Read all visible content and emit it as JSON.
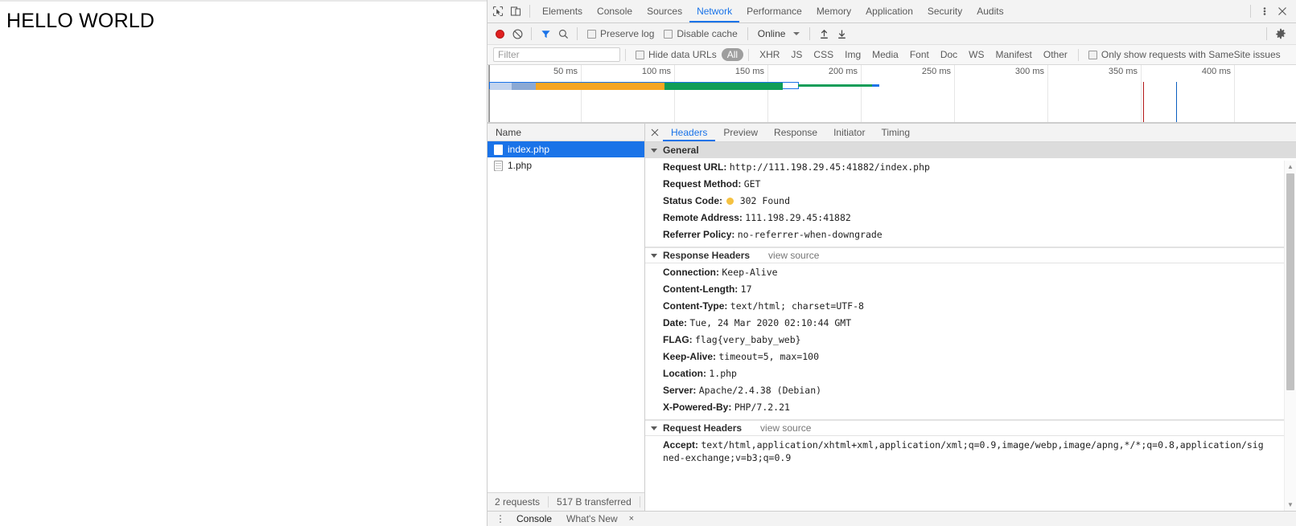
{
  "page": {
    "heading": "HELLO WORLD"
  },
  "devtools": {
    "main_tabs": [
      {
        "label": "Elements",
        "active": false
      },
      {
        "label": "Console",
        "active": false
      },
      {
        "label": "Sources",
        "active": false
      },
      {
        "label": "Network",
        "active": true
      },
      {
        "label": "Performance",
        "active": false
      },
      {
        "label": "Memory",
        "active": false
      },
      {
        "label": "Application",
        "active": false
      },
      {
        "label": "Security",
        "active": false
      },
      {
        "label": "Audits",
        "active": false
      }
    ],
    "inspect_icon": "inspect-element-icon",
    "device_icon": "device-toolbar-icon",
    "more_icon": "kebab-menu-icon",
    "close_icon": "close-icon",
    "network_toolbar": {
      "record_icon": "record-button-icon",
      "clear_icon": "clear-icon",
      "filter_icon": "filter-funnel-icon",
      "search_icon": "search-icon",
      "preserve_log_label": "Preserve log",
      "preserve_log_checked": false,
      "disable_cache_label": "Disable cache",
      "disable_cache_checked": false,
      "throttle_value": "Online",
      "import_icon": "import-har-icon",
      "export_icon": "export-har-icon",
      "settings_icon": "gear-icon"
    },
    "filter_bar": {
      "filter_placeholder": "Filter",
      "filter_value": "",
      "hide_data_urls_label": "Hide data URLs",
      "hide_data_urls_checked": false,
      "types": [
        {
          "label": "All",
          "active": true
        },
        {
          "label": "XHR",
          "active": false
        },
        {
          "label": "JS",
          "active": false
        },
        {
          "label": "CSS",
          "active": false
        },
        {
          "label": "Img",
          "active": false
        },
        {
          "label": "Media",
          "active": false
        },
        {
          "label": "Font",
          "active": false
        },
        {
          "label": "Doc",
          "active": false
        },
        {
          "label": "WS",
          "active": false
        },
        {
          "label": "Manifest",
          "active": false
        },
        {
          "label": "Other",
          "active": false
        }
      ],
      "samesite_label": "Only show requests with SameSite issues",
      "samesite_checked": false
    },
    "overview": {
      "ticks": [
        "50 ms",
        "100 ms",
        "150 ms",
        "200 ms",
        "250 ms",
        "300 ms",
        "350 ms",
        "400 ms"
      ],
      "colors": {
        "queueing": "#b3c9e8",
        "stalled": "#8ba9d4",
        "waiting": "#f5a623",
        "download": "#0f9d58",
        "border": "#1a73e8",
        "dom_content_loaded": "#0b5fbf",
        "load": "#b31919"
      }
    },
    "request_list": {
      "column_header": "Name",
      "rows": [
        {
          "name": "index.php",
          "selected": true
        },
        {
          "name": "1.php",
          "selected": false
        }
      ],
      "footer": {
        "requests": "2 requests",
        "transferred": "517 B transferred"
      }
    },
    "detail": {
      "tabs": [
        {
          "label": "Headers",
          "active": true
        },
        {
          "label": "Preview",
          "active": false
        },
        {
          "label": "Response",
          "active": false
        },
        {
          "label": "Initiator",
          "active": false
        },
        {
          "label": "Timing",
          "active": false
        }
      ],
      "sections": [
        {
          "title": "General",
          "style": "filled",
          "view_source": "",
          "rows": [
            {
              "key": "Request URL:",
              "value": "http://111.198.29.45:41882/index.php"
            },
            {
              "key": "Request Method:",
              "value": "GET"
            },
            {
              "key": "Status Code:",
              "value": "302 Found",
              "status_dot": true
            },
            {
              "key": "Remote Address:",
              "value": "111.198.29.45:41882"
            },
            {
              "key": "Referrer Policy:",
              "value": "no-referrer-when-downgrade"
            }
          ]
        },
        {
          "title": "Response Headers",
          "style": "plain",
          "view_source": "view source",
          "rows": [
            {
              "key": "Connection:",
              "value": "Keep-Alive"
            },
            {
              "key": "Content-Length:",
              "value": "17"
            },
            {
              "key": "Content-Type:",
              "value": "text/html; charset=UTF-8"
            },
            {
              "key": "Date:",
              "value": "Tue, 24 Mar 2020 02:10:44 GMT"
            },
            {
              "key": "FLAG:",
              "value": "flag{very_baby_web}"
            },
            {
              "key": "Keep-Alive:",
              "value": "timeout=5, max=100"
            },
            {
              "key": "Location:",
              "value": "1.php"
            },
            {
              "key": "Server:",
              "value": "Apache/2.4.38 (Debian)"
            },
            {
              "key": "X-Powered-By:",
              "value": "PHP/7.2.21"
            }
          ]
        },
        {
          "title": "Request Headers",
          "style": "plain",
          "view_source": "view source",
          "rows": [
            {
              "key": "Accept:",
              "value": "text/html,application/xhtml+xml,application/xml;q=0.9,image/webp,image/apng,*/*;q=0.8,application/signed-exchange;v=b3;q=0.9"
            }
          ]
        }
      ]
    },
    "drawer": {
      "menu_icon": "kebab-menu-icon",
      "tabs": [
        {
          "label": "Console",
          "active": true
        },
        {
          "label": "What's New",
          "active": false
        }
      ],
      "close_label": "×"
    }
  }
}
